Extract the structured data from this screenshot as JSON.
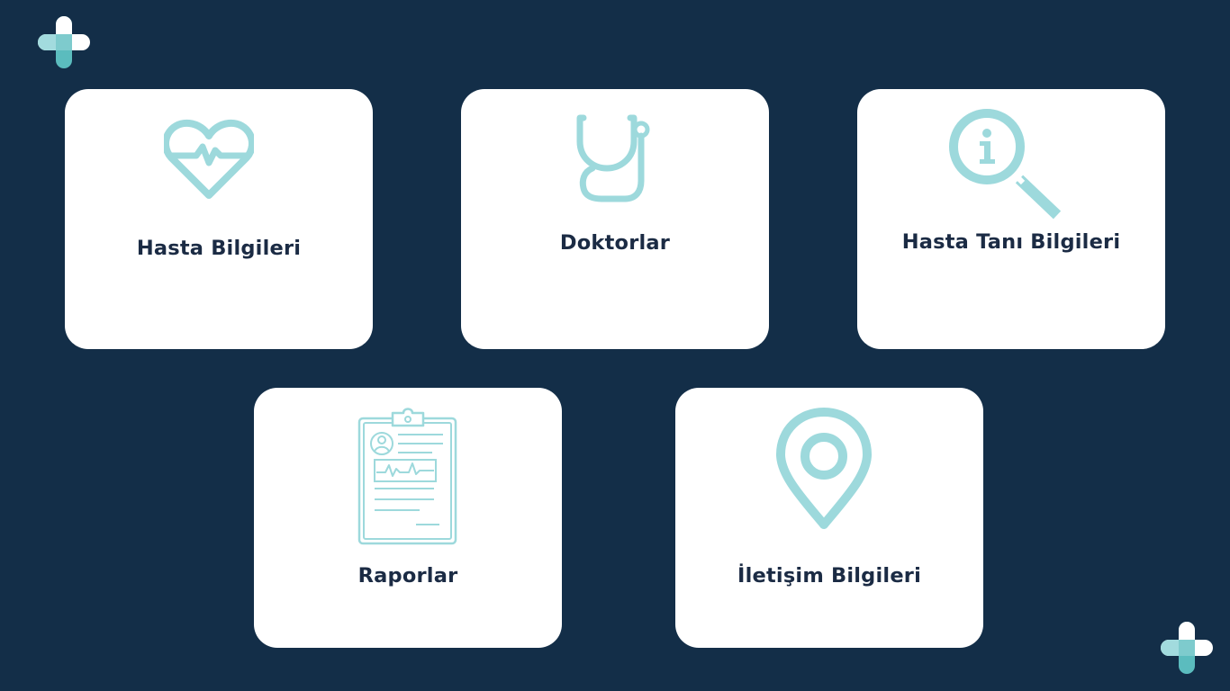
{
  "brand": {
    "logo_icon": "medical-cross-icon",
    "primary_color": "#132e48",
    "accent_color": "#9dd9dc",
    "accent_dark": "#5bbcbe"
  },
  "menu": {
    "items": [
      {
        "label": "Hasta Bilgileri",
        "icon": "heart-pulse-icon"
      },
      {
        "label": "Doktorlar",
        "icon": "stethoscope-icon"
      },
      {
        "label": "Hasta Tanı Bilgileri",
        "icon": "info-search-icon"
      },
      {
        "label": "Raporlar",
        "icon": "clipboard-report-icon"
      },
      {
        "label": "İletişim Bilgileri",
        "icon": "location-pin-icon"
      }
    ]
  }
}
